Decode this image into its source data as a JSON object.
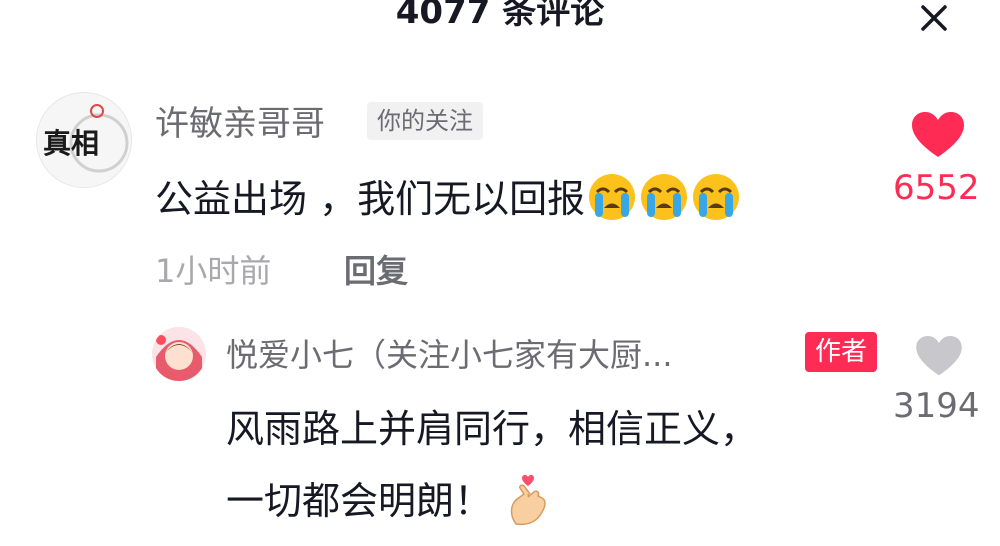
{
  "header": {
    "title": "4077 条评论"
  },
  "comment": {
    "author": "许敏亲哥哥",
    "follow_tag": "你的关注",
    "text": "公益出场 ，我们无以回报",
    "emoji_icons": [
      "loudly-crying-face-icon",
      "loudly-crying-face-icon",
      "loudly-crying-face-icon"
    ],
    "likes": "6552",
    "time": "1小时前",
    "reply_label": "回复",
    "avatar_text": "真相",
    "heart_color": "#fe2c55"
  },
  "reply": {
    "author": "悦爱小七（关注小七家有大厨...",
    "author_tag": "作者",
    "likes": "3194",
    "text_line1": "风雨路上并肩同行，相信正义，",
    "text_line2": "一切都会明朗！",
    "emoji_icon": "finger-heart-icon",
    "heart_color": "#c8c8cc"
  }
}
